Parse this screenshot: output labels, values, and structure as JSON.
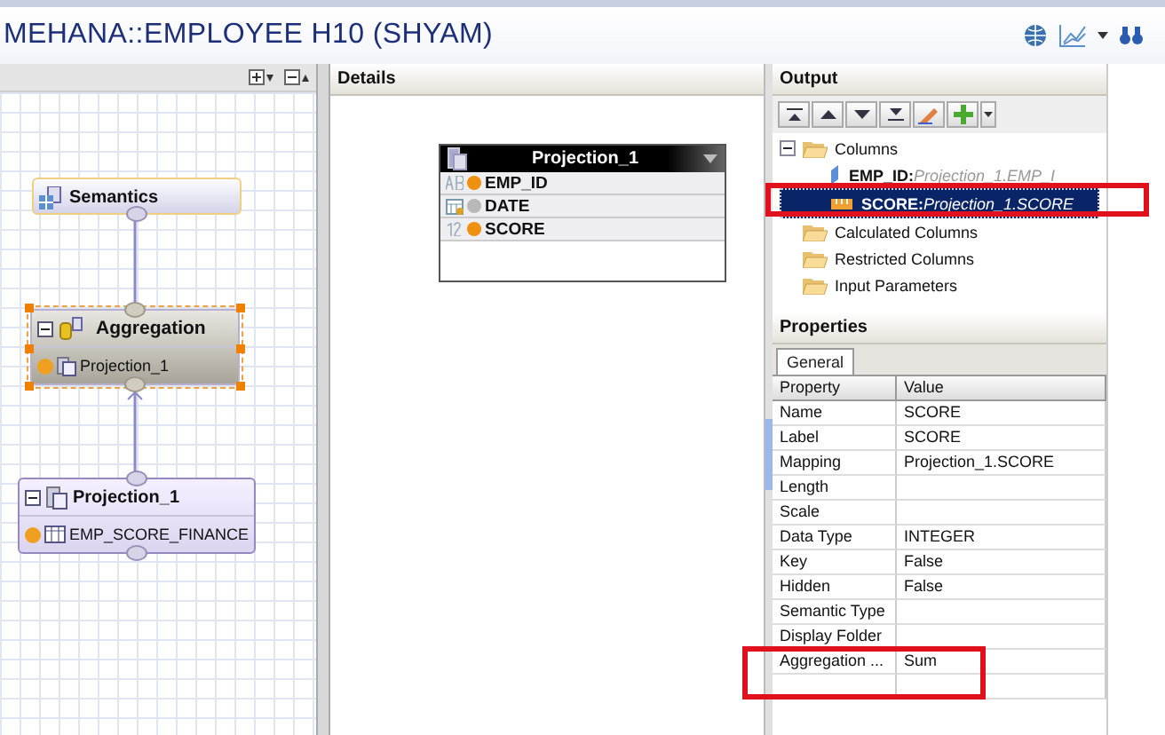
{
  "window": {
    "title": "MEHANA::EMPLOYEE H10 (SHYAM)"
  },
  "canvas": {
    "nodes": [
      {
        "kind": "semantics",
        "label": "Semantics",
        "selected": false,
        "expanded": false
      },
      {
        "kind": "aggregation",
        "label": "Aggregation",
        "selected": true,
        "expanded": true,
        "input": "Projection_1"
      },
      {
        "kind": "projection",
        "label": "Projection_1",
        "selected": false,
        "expanded": true,
        "input": "EMP_SCORE_FINANCE"
      }
    ]
  },
  "details": {
    "title": "Details",
    "table": {
      "title": "Projection_1",
      "columns": [
        {
          "kind": "text",
          "name": "EMP_ID",
          "mapped": true
        },
        {
          "kind": "date",
          "name": "DATE",
          "mapped": false
        },
        {
          "kind": "number",
          "name": "SCORE",
          "mapped": true
        }
      ]
    }
  },
  "output": {
    "title": "Output",
    "tree": [
      {
        "label": "Columns",
        "expanded": true,
        "children": [
          {
            "kind": "key",
            "name": "EMP_ID:",
            "mapping": "Projection_1.EMP_I",
            "selected": false
          },
          {
            "kind": "measure",
            "name": "SCORE:",
            "mapping": "Projection_1.SCORE",
            "selected": true
          }
        ]
      },
      {
        "label": "Calculated Columns",
        "expanded": false
      },
      {
        "label": "Restricted Columns",
        "expanded": false
      },
      {
        "label": "Input Parameters",
        "expanded": false
      }
    ]
  },
  "properties": {
    "title": "Properties",
    "tabs": [
      {
        "label": "General",
        "selected": true
      }
    ],
    "columns": [
      "Property",
      "Value"
    ],
    "rows": [
      [
        "Name",
        "SCORE"
      ],
      [
        "Label",
        "SCORE"
      ],
      [
        "Mapping",
        "Projection_1.SCORE"
      ],
      [
        "Length",
        ""
      ],
      [
        "Scale",
        ""
      ],
      [
        "Data Type",
        "INTEGER"
      ],
      [
        "Key",
        "False"
      ],
      [
        "Hidden",
        "False"
      ],
      [
        "Semantic Type",
        ""
      ],
      [
        "Display Folder",
        ""
      ],
      [
        "Aggregation ...",
        "Sum"
      ],
      [
        "",
        ""
      ]
    ]
  }
}
